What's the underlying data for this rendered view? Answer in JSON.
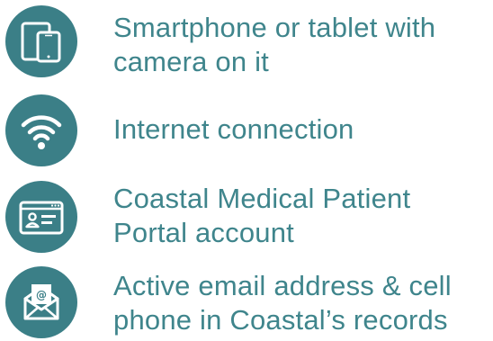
{
  "requirements": [
    {
      "icon": "devices-icon",
      "lines": [
        "Smartphone or tablet with",
        "camera on it"
      ]
    },
    {
      "icon": "wifi-icon",
      "lines": [
        "Internet connection"
      ]
    },
    {
      "icon": "id-card-browser-icon",
      "lines": [
        "Coastal Medical Patient",
        "Portal account"
      ]
    },
    {
      "icon": "email-envelope-icon",
      "lines": [
        "Active email address & cell",
        "phone in Coastal’s records"
      ]
    }
  ],
  "colors": {
    "icon_background": "#3b7f87",
    "text": "#3f858c",
    "icon_foreground": "#ffffff"
  }
}
